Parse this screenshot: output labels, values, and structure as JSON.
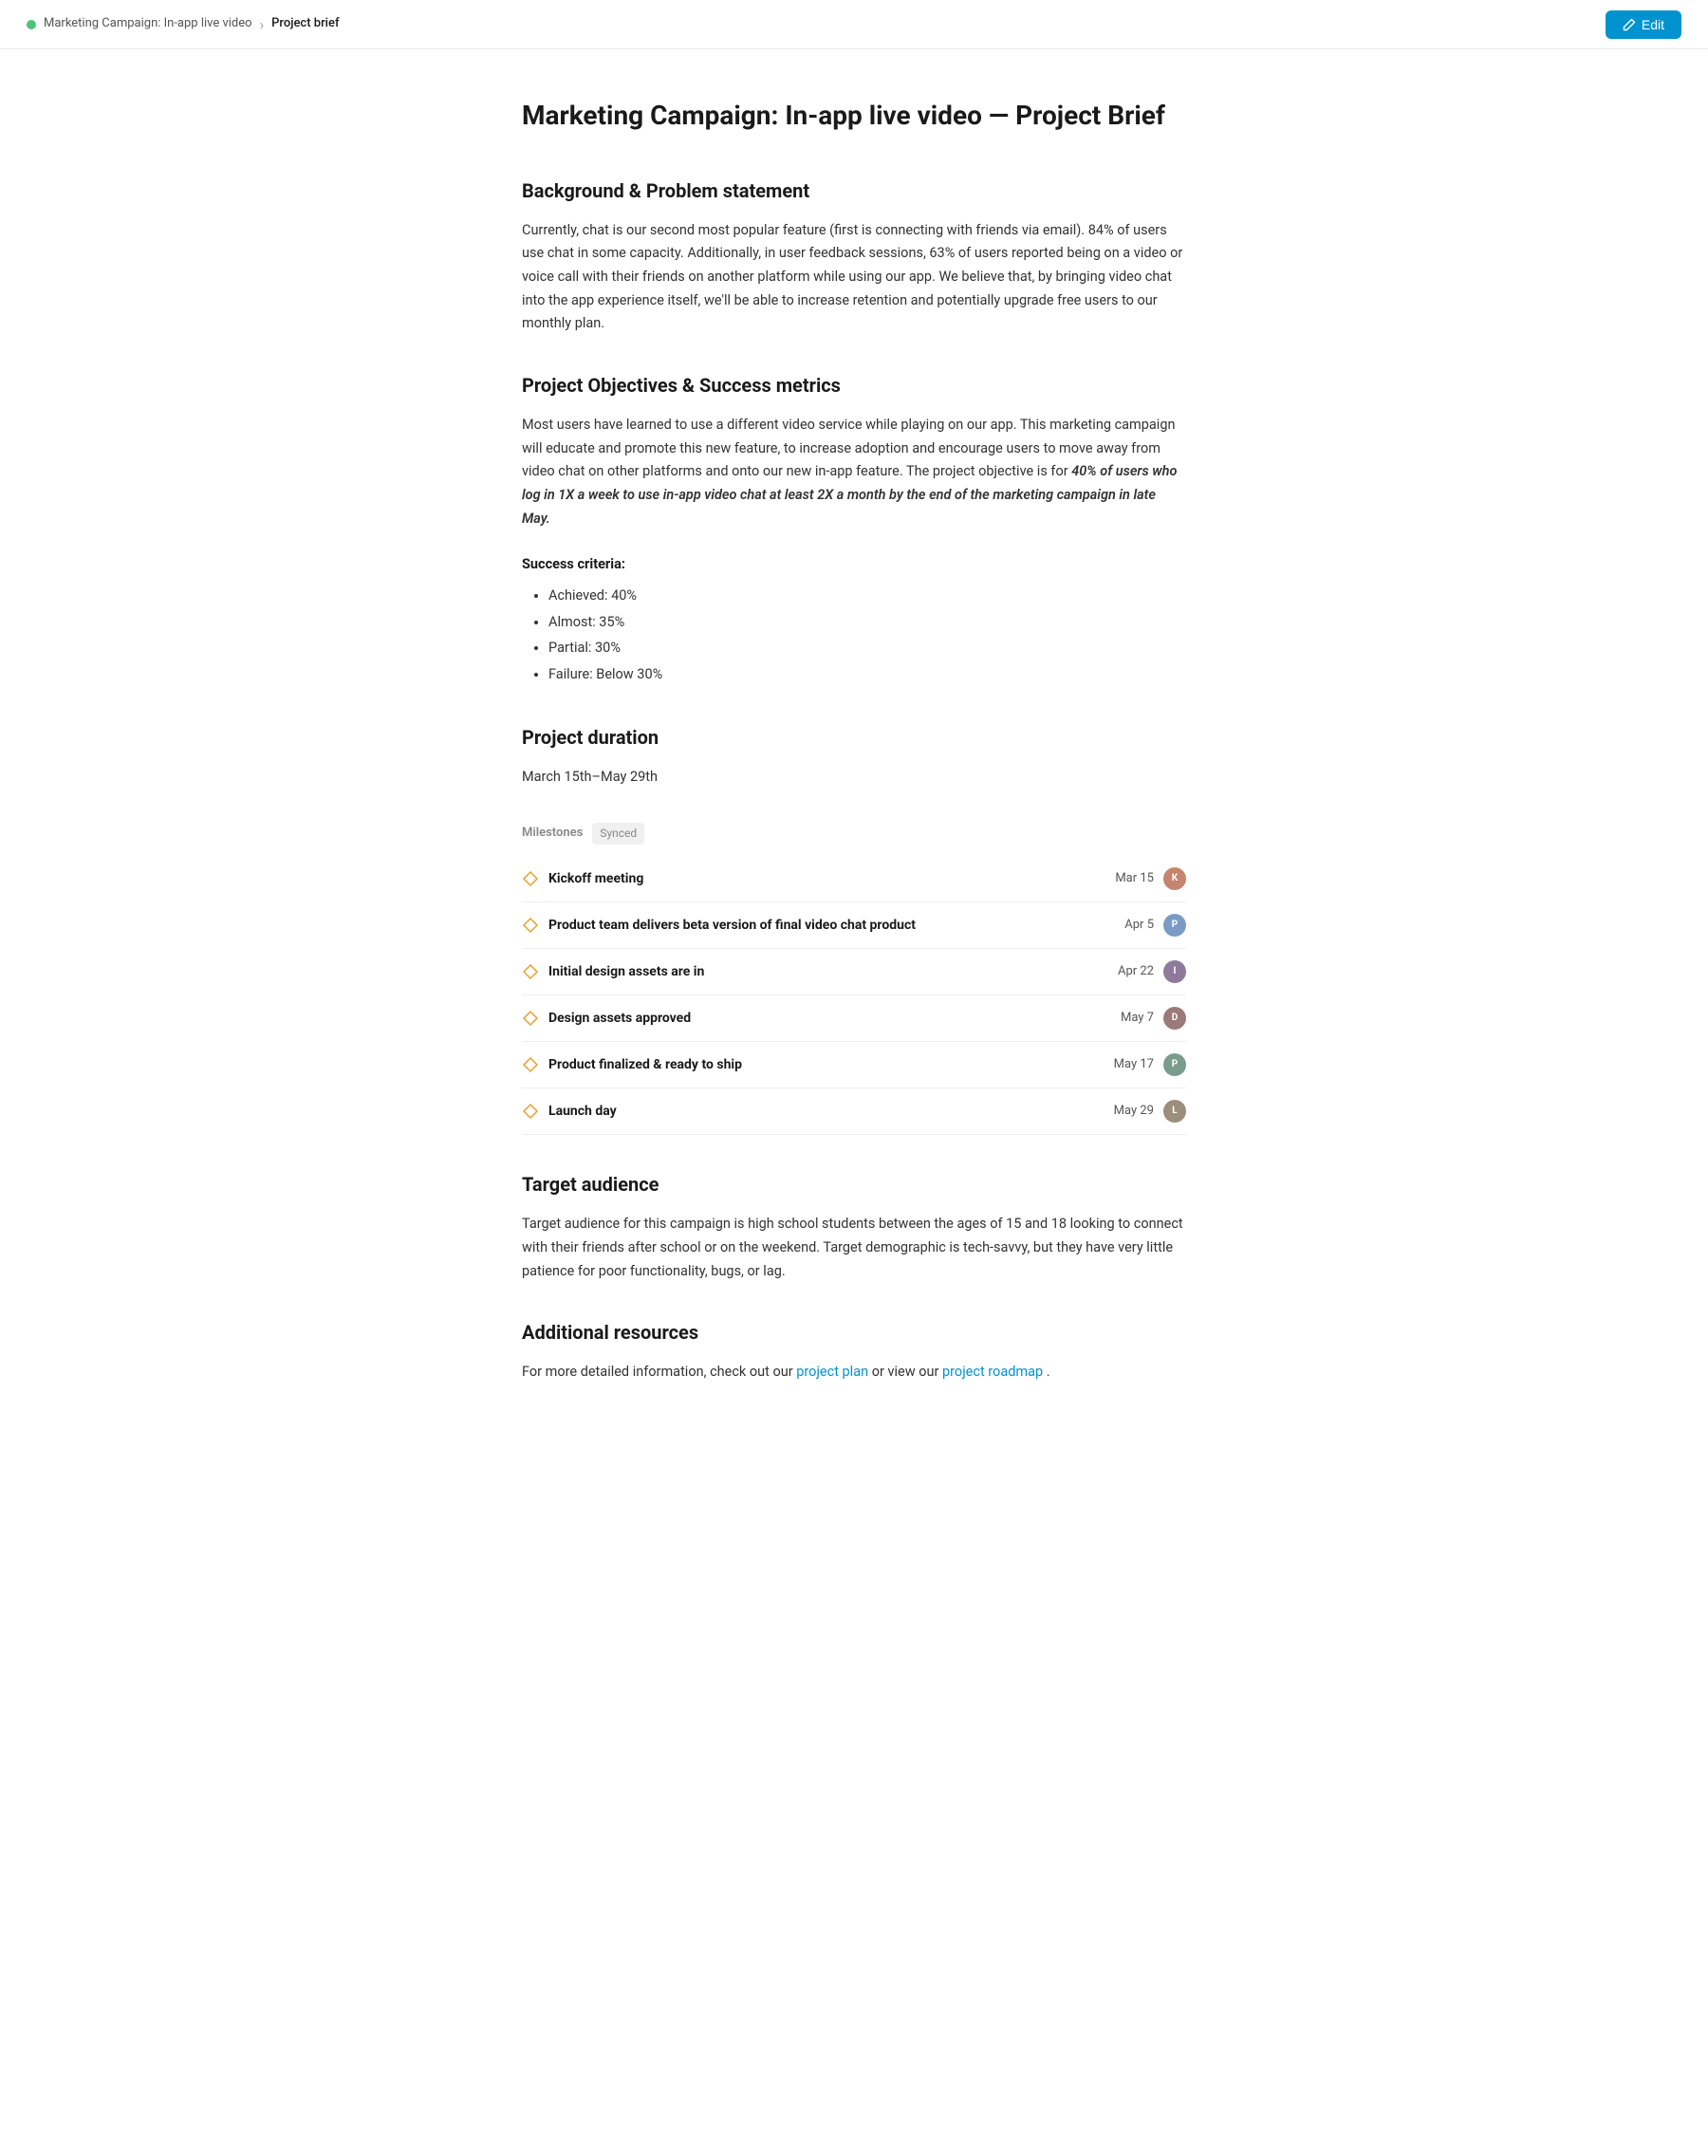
{
  "topbar": {
    "breadcrumb_parent": "Marketing Campaign: In-app live video",
    "breadcrumb_current": "Project brief",
    "edit_label": "Edit"
  },
  "page": {
    "title": "Marketing Campaign: In-app live video — Project Brief",
    "sections": {
      "background": {
        "heading": "Background & Problem statement",
        "text": "Currently, chat is our second most popular feature (first is connecting with friends via email). 84% of users use chat in some capacity. Additionally, in user feedback sessions, 63% of users reported being on a video or voice call with their friends on another platform while using our app. We believe that, by bringing video chat into the app experience itself, we'll be able to increase retention and potentially upgrade free users to our monthly plan."
      },
      "objectives": {
        "heading": "Project Objectives & Success metrics",
        "text_before": "Most users have learned to use a different video service while playing on our app. This marketing campaign will educate and promote this new feature, to increase adoption and encourage users to move away from video chat on other platforms and onto our new in-app feature. The project objective is for",
        "text_italic": "40% of users who log in 1X a week to use in-app video chat at least 2X a month by the end of the marketing campaign in late May.",
        "success_criteria_heading": "Success criteria:",
        "success_list": [
          "Achieved: 40%",
          "Almost: 35%",
          "Partial: 30%",
          "Failure: Below 30%"
        ]
      },
      "duration": {
        "heading": "Project duration",
        "text": "March 15th–May 29th"
      },
      "milestones": {
        "label": "Milestones",
        "synced": "Synced",
        "items": [
          {
            "title": "Kickoff meeting",
            "date": "Mar 15",
            "avatar_class": "avatar-1",
            "avatar_initials": "K"
          },
          {
            "title": "Product team delivers beta version of final video chat product",
            "date": "Apr 5",
            "avatar_class": "avatar-2",
            "avatar_initials": "P"
          },
          {
            "title": "Initial design assets are in",
            "date": "Apr 22",
            "avatar_class": "avatar-3",
            "avatar_initials": "I"
          },
          {
            "title": "Design assets approved",
            "date": "May 7",
            "avatar_class": "avatar-4",
            "avatar_initials": "D"
          },
          {
            "title": "Product finalized & ready to ship",
            "date": "May 17",
            "avatar_class": "avatar-5",
            "avatar_initials": "P"
          },
          {
            "title": "Launch day",
            "date": "May 29",
            "avatar_class": "avatar-6",
            "avatar_initials": "L"
          }
        ]
      },
      "target": {
        "heading": "Target audience",
        "text": "Target audience for this campaign is high school students between the ages of 15 and 18 looking to connect with their friends after school or on the weekend. Target demographic is tech-savvy, but they have very little patience for poor functionality, bugs, or lag."
      },
      "resources": {
        "heading": "Additional resources",
        "text_before": "For more detailed information, check out our",
        "link1_text": "project plan",
        "text_middle": "or view our",
        "link2_text": "project roadmap",
        "text_after": "."
      }
    }
  }
}
